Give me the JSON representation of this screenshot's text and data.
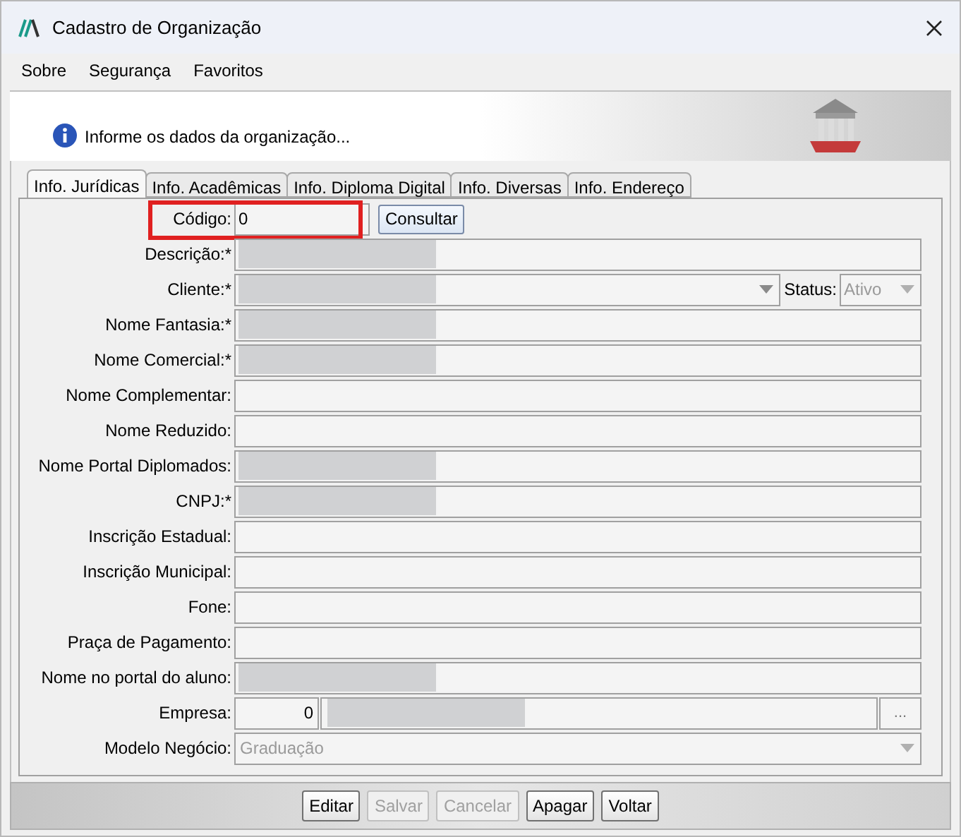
{
  "window": {
    "title": "Cadastro de Organização"
  },
  "menu": [
    {
      "label": "Sobre"
    },
    {
      "label": "Segurança"
    },
    {
      "label": "Favoritos"
    }
  ],
  "header": {
    "message": "Informe os dados da organização..."
  },
  "tabs": [
    {
      "label": "Info. Jurídicas",
      "selected": true
    },
    {
      "label": "Info. Acadêmicas",
      "selected": false
    },
    {
      "label": "Info. Diploma Digital",
      "selected": false
    },
    {
      "label": "Info. Diversas",
      "selected": false
    },
    {
      "label": "Info. Endereço",
      "selected": false
    }
  ],
  "rows": [
    {
      "kind": "code",
      "label": "Código:",
      "value": "0",
      "highlighted": true,
      "button": "Consultar"
    },
    {
      "kind": "text",
      "label": "Descrição:*",
      "redacted": true
    },
    {
      "kind": "client",
      "label": "Cliente:*",
      "redacted": true,
      "status_label": "Status:",
      "status_value": "Ativo",
      "status_disabled": true
    },
    {
      "kind": "text",
      "label": "Nome Fantasia:*",
      "redacted": true
    },
    {
      "kind": "text",
      "label": "Nome Comercial:*",
      "redacted": true
    },
    {
      "kind": "text",
      "label": "Nome Complementar:",
      "redacted": false
    },
    {
      "kind": "text",
      "label": "Nome Reduzido:",
      "redacted": false
    },
    {
      "kind": "text",
      "label": "Nome Portal Diplomados:",
      "redacted": true
    },
    {
      "kind": "text",
      "label": "CNPJ:*",
      "redacted": true
    },
    {
      "kind": "text",
      "label": "Inscrição Estadual:",
      "redacted": false
    },
    {
      "kind": "text",
      "label": "Inscrição Municipal:",
      "redacted": false
    },
    {
      "kind": "text",
      "label": "Fone:",
      "redacted": false
    },
    {
      "kind": "text",
      "label": "Praça de Pagamento:",
      "redacted": false
    },
    {
      "kind": "text",
      "label": "Nome no portal do aluno:",
      "redacted": true
    },
    {
      "kind": "lookup",
      "label": "Empresa:",
      "code": "0",
      "redacted": true,
      "button": "..."
    },
    {
      "kind": "select",
      "label": "Modelo Negócio:",
      "value": "Graduação",
      "disabled": true
    }
  ],
  "buttons": [
    {
      "label": "Editar",
      "disabled": false
    },
    {
      "label": "Salvar",
      "disabled": true
    },
    {
      "label": "Cancelar",
      "disabled": true
    },
    {
      "label": "Apagar",
      "disabled": false
    },
    {
      "label": "Voltar",
      "disabled": false
    }
  ]
}
